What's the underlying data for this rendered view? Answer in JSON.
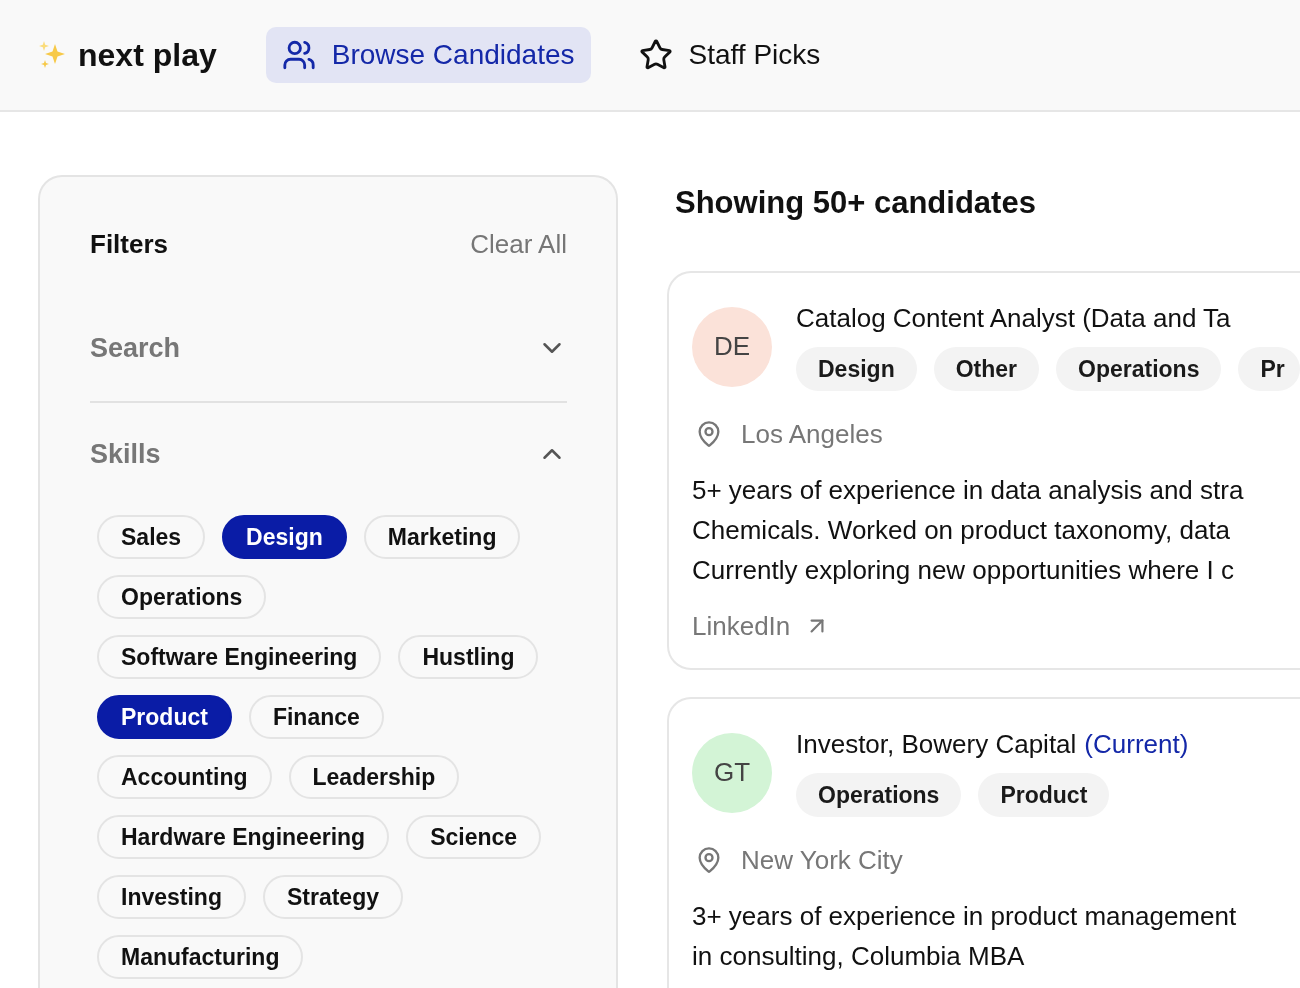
{
  "header": {
    "logo": "next play",
    "nav": [
      {
        "label": "Browse Candidates",
        "selected": true
      },
      {
        "label": "Staff Picks",
        "selected": false
      }
    ]
  },
  "filters": {
    "title": "Filters",
    "clear_label": "Clear All",
    "sections": [
      {
        "title": "Search",
        "expanded": false
      },
      {
        "title": "Skills",
        "expanded": true,
        "chips": [
          {
            "label": "Sales",
            "selected": false
          },
          {
            "label": "Design",
            "selected": true
          },
          {
            "label": "Marketing",
            "selected": false
          },
          {
            "label": "Operations",
            "selected": false
          },
          {
            "label": "Software Engineering",
            "selected": false
          },
          {
            "label": "Hustling",
            "selected": false
          },
          {
            "label": "Product",
            "selected": true
          },
          {
            "label": "Finance",
            "selected": false
          },
          {
            "label": "Accounting",
            "selected": false
          },
          {
            "label": "Leadership",
            "selected": false
          },
          {
            "label": "Hardware Engineering",
            "selected": false
          },
          {
            "label": "Science",
            "selected": false
          },
          {
            "label": "Investing",
            "selected": false
          },
          {
            "label": "Strategy",
            "selected": false
          },
          {
            "label": "Manufacturing",
            "selected": false
          }
        ]
      }
    ]
  },
  "results": {
    "heading": "Showing 50+ candidates",
    "candidates": [
      {
        "initials": "DE",
        "color": "#fbe2d9",
        "title": "Catalog Content Analyst (Data and Ta",
        "tags": [
          "Design",
          "Other",
          "Operations",
          "Pr"
        ],
        "location": "Los Angeles",
        "description_lines": [
          "5+ years of experience in data analysis and stra",
          "Chemicals. Worked on product taxonomy, data",
          "Currently exploring new opportunities where I c"
        ],
        "link": "LinkedIn"
      },
      {
        "initials": "GT",
        "color": "#d3f4d6",
        "title": "Investor, Bowery Capital",
        "current_label": "(Current)",
        "tags": [
          "Operations",
          "Product"
        ],
        "location": "New York City",
        "description_lines": [
          "3+ years of experience in product management",
          "in consulting, Columbia MBA"
        ]
      }
    ]
  }
}
